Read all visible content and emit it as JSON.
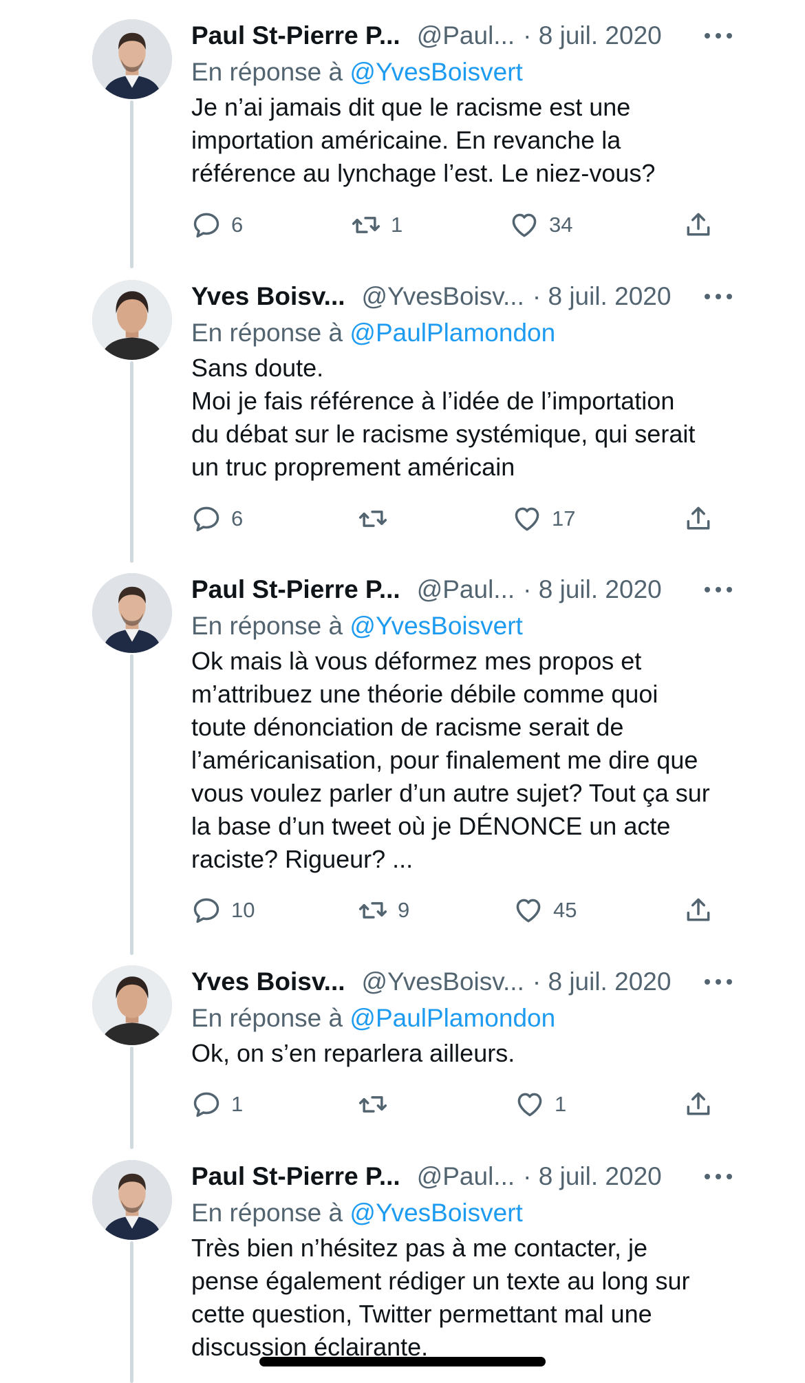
{
  "tweets": [
    {
      "name": "Paul St-Pierre P...",
      "handle": "@Paul...",
      "date": "· 8 juil. 2020",
      "reply_prefix": "En réponse à",
      "reply_to": "@YvesBoisvert",
      "lines": [
        "Je n’ai jamais dit que le racisme est une",
        "importation américaine. En revanche la",
        "référence au lynchage l’est. Le niez-vous?"
      ],
      "replies": "6",
      "retweets": "1",
      "likes": "34"
    },
    {
      "name": "Yves Boisv...",
      "handle": "@YvesBoisv...",
      "date": "· 8 juil. 2020",
      "reply_prefix": "En réponse à",
      "reply_to": "@PaulPlamondon",
      "lines": [
        "Sans doute.",
        "Moi je fais référence à l’idée de l’importation",
        "du débat sur le racisme systémique, qui serait",
        "un truc proprement américain"
      ],
      "replies": "6",
      "retweets": "",
      "likes": "17"
    },
    {
      "name": "Paul St-Pierre P...",
      "handle": "@Paul...",
      "date": "· 8 juil. 2020",
      "reply_prefix": "En réponse à",
      "reply_to": "@YvesBoisvert",
      "lines": [
        "Ok mais là vous déformez mes propos et",
        "m’attribuez une théorie débile comme quoi",
        "toute dénonciation de racisme serait de",
        "l’américanisation, pour finalement me dire que",
        "vous voulez parler d’un autre sujet? Tout ça sur",
        "la base d’un tweet où je DÉNONCE un acte",
        "raciste? Rigueur? ..."
      ],
      "replies": "10",
      "retweets": "9",
      "likes": "45"
    },
    {
      "name": "Yves Boisv...",
      "handle": "@YvesBoisv...",
      "date": "· 8 juil. 2020",
      "reply_prefix": "En réponse à",
      "reply_to": "@PaulPlamondon",
      "lines": [
        "Ok, on s’en reparlera ailleurs."
      ],
      "replies": "1",
      "retweets": "",
      "likes": "1"
    },
    {
      "name": "Paul St-Pierre P...",
      "handle": "@Paul...",
      "date": "· 8 juil. 2020",
      "reply_prefix": "En réponse à",
      "reply_to": "@YvesBoisvert",
      "lines": [
        "Très bien n’hésitez pas à me contacter, je",
        "pense également rédiger un texte au long sur",
        "cette question, Twitter permettant mal une",
        "discussion éclairante."
      ],
      "replies": "",
      "retweets": "",
      "likes": ""
    }
  ],
  "icons": {
    "reply": "reply-icon",
    "retweet": "retweet-icon",
    "like": "heart-icon",
    "share": "share-icon",
    "more": "more-icon"
  },
  "colors": {
    "link": "#1d9bf0",
    "secondary_text": "#536471",
    "thread_line": "#cfd9de"
  }
}
